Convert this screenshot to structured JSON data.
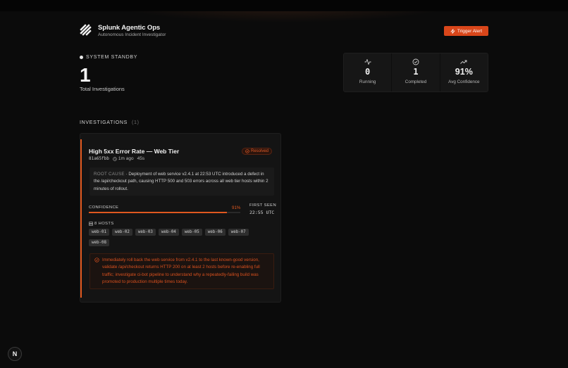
{
  "header": {
    "title": "Splunk Agentic Ops",
    "subtitle": "Autonomous Incident Investigator",
    "trigger_label": "Trigger Alert",
    "logo_icon": "splunk-logo-icon",
    "trigger_icon": "zap-icon"
  },
  "status": {
    "label": "SYSTEM STANDBY",
    "total": "1",
    "total_caption": "Total Investigations"
  },
  "stats": [
    {
      "icon": "activity-icon",
      "value": "0",
      "label": "Running"
    },
    {
      "icon": "check-circle-icon",
      "value": "1",
      "label": "Completed"
    },
    {
      "icon": "trending-up-icon",
      "value": "91%",
      "label": "Avg Confidence"
    }
  ],
  "investigations": {
    "heading": "INVESTIGATIONS",
    "count": "(1)",
    "items": [
      {
        "title": "High 5xx Error Rate — Web Tier",
        "status": "Resolved",
        "id": "81a65fbb",
        "age": "1m ago",
        "duration": "45s",
        "root_cause_label": "ROOT CAUSE",
        "root_cause": "Deployment of web service v2.4.1 at 22:53 UTC introduced a defect in the /api/checkout path, causing HTTP 500 and 503 errors across all web tier hosts within 2 minutes of rollout.",
        "confidence_label": "CONFIDENCE",
        "confidence_text": "91%",
        "confidence": 0.91,
        "first_seen_label": "FIRST SEEN",
        "first_seen": "22:55 UTC",
        "hosts_label": "8 HOSTS",
        "hosts": [
          "web-01",
          "web-02",
          "web-03",
          "web-04",
          "web-05",
          "web-06",
          "web-07",
          "web-08"
        ],
        "action": "Immediately roll back the web service from v2.4.1 to the last known-good version, validate /api/checkout returns HTTP 200 on at least 2 hosts before re-enabling full traffic; investigate ci-bot pipeline to understand why a repeatedly-failing build was promoted to production multiple times today."
      }
    ]
  },
  "footer": {
    "badge": "N"
  },
  "colors": {
    "accent": "#e0581f",
    "button": "#d9461a",
    "background": "#0b0b0b"
  }
}
